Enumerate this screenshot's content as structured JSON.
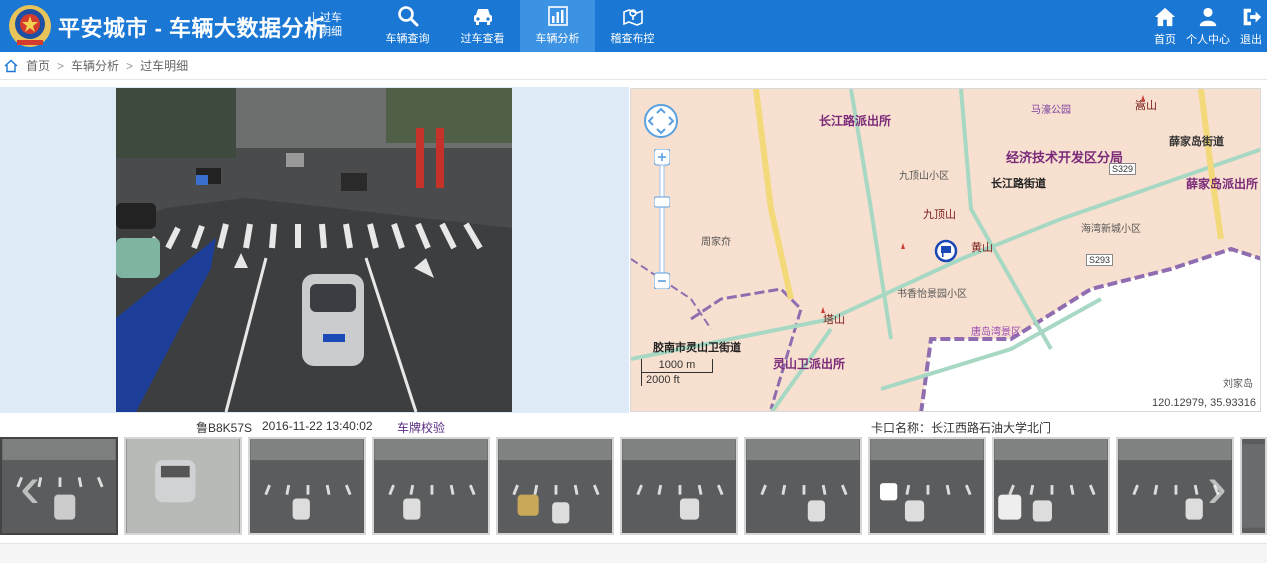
{
  "header": {
    "app_title": "平安城市 - 车辆大数据分析",
    "page_sub": "过车明细",
    "nav": [
      {
        "label": "车辆查询",
        "icon": "search-icon"
      },
      {
        "label": "过车查看",
        "icon": "car-icon"
      },
      {
        "label": "车辆分析",
        "icon": "bar-chart-icon",
        "active": true
      },
      {
        "label": "稽查布控",
        "icon": "map-pin-icon"
      }
    ],
    "right_nav": [
      {
        "label": "首页",
        "icon": "home-icon"
      },
      {
        "label": "个人中心",
        "icon": "user-icon"
      },
      {
        "label": "退出",
        "icon": "logout-icon"
      }
    ]
  },
  "breadcrumb": [
    "首页",
    "车辆分析",
    "过车明细"
  ],
  "map": {
    "labels": {
      "mawan_park": "马濠公园",
      "songshan": "嵩山",
      "changjianglu_police": "长江路派出所",
      "jingji_branch": "经济技术开发区分局",
      "xuejiadao_street": "薛家岛街道",
      "xuejiadao_police": "薛家岛派出所",
      "jiudingshan_xq": "九顶山小区",
      "changjianglu_street": "长江路街道",
      "jiudingshan": "九顶山",
      "haiwan_xincheng": "海湾新城小区",
      "huangshan": "黄山",
      "zhoujiaqi": "周家夼",
      "shuxiang": "书香怡景园小区",
      "tashan": "塔山",
      "tangdao": "唐岛湾景区",
      "jiaonan_street": "胶南市灵山卫街道",
      "lingshanwei_police": "灵山卫派出所",
      "liujiadao": "刘家岛",
      "road_s329": "S329",
      "road_s293": "S293"
    },
    "scale_m": "1000 m",
    "scale_ft": "2000 ft",
    "coords": "120.12979, 35.93316"
  },
  "info": {
    "plate": "鲁B8K57S",
    "time": "2016-11-22 13:40:02",
    "verify_label": "车牌校验",
    "site": "卡口名称：长江西路石油大学北门"
  },
  "colors": {
    "header_bg": "#1a78d4",
    "nav_active": "#3c93e3",
    "verify": "#5a2d82",
    "map_bg": "#f7e0cf"
  }
}
